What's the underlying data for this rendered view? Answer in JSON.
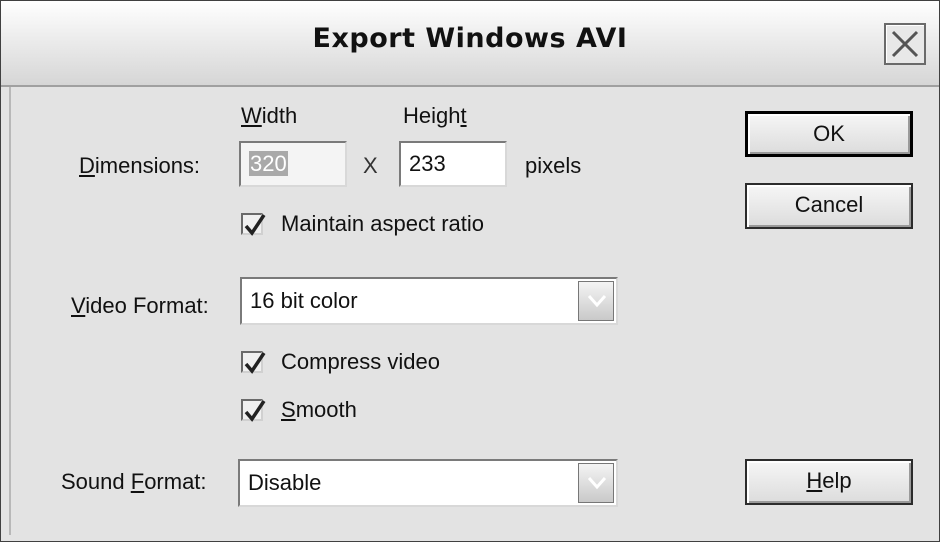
{
  "dialog": {
    "title": "Export Windows AVI"
  },
  "dimensions": {
    "label": "Dimensions:",
    "label_mnemonic": "D",
    "label_rest": "imensions:",
    "width_header": "Width",
    "width_header_mnemonic": "W",
    "width_header_rest": "idth",
    "height_header": "Height",
    "height_header_prefix": "Heigh",
    "height_header_mnemonic": "t",
    "width_value": "320",
    "times_symbol": "X",
    "height_value": "233",
    "unit": "pixels",
    "maintain_aspect_ratio": {
      "label": "Maintain aspect ratio",
      "checked": true
    }
  },
  "video": {
    "label": "Video Format:",
    "label_mnemonic": "V",
    "label_rest": "ideo Format:",
    "selected": "16 bit color",
    "compress": {
      "label": "Compress video",
      "checked": true
    },
    "smooth": {
      "label": "Smooth",
      "label_mnemonic": "S",
      "label_rest": "mooth",
      "checked": true
    }
  },
  "sound": {
    "label": "Sound Format:",
    "label_prefix": "Sound ",
    "label_mnemonic": "F",
    "label_rest": "ormat:",
    "selected": "Disable"
  },
  "buttons": {
    "ok": "OK",
    "cancel": "Cancel",
    "help": "Help",
    "help_mnemonic": "H",
    "help_rest": "elp"
  }
}
